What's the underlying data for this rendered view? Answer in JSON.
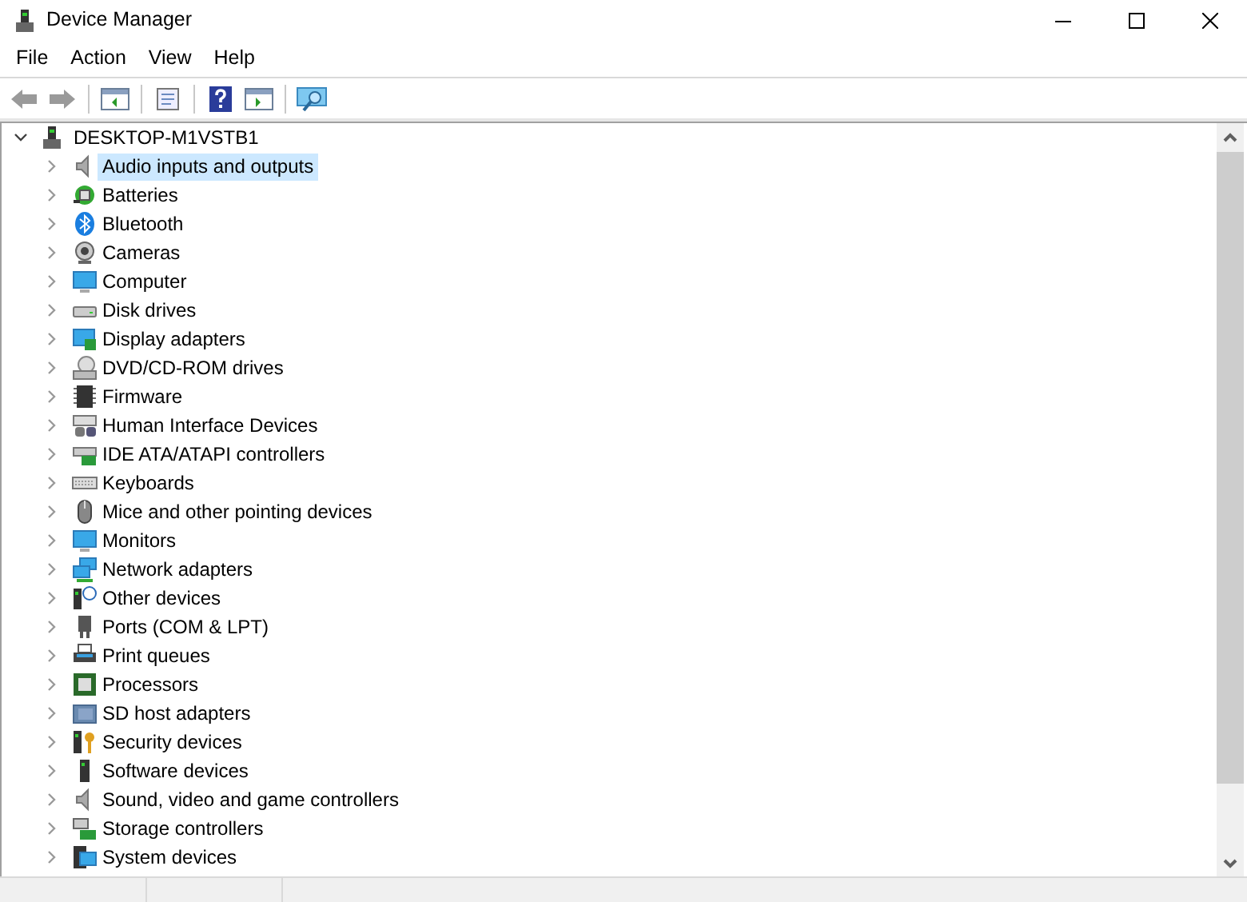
{
  "window": {
    "title": "Device Manager"
  },
  "menu": [
    "File",
    "Action",
    "View",
    "Help"
  ],
  "tree": {
    "label": "DESKTOP-M1VSTB1",
    "expanded": true,
    "children": [
      {
        "label": "Audio inputs and outputs",
        "selected": true,
        "expanded": false
      },
      {
        "label": "Batteries",
        "selected": false,
        "expanded": false
      },
      {
        "label": "Bluetooth",
        "selected": false,
        "expanded": false
      },
      {
        "label": "Cameras",
        "selected": false,
        "expanded": false
      },
      {
        "label": "Computer",
        "selected": false,
        "expanded": false
      },
      {
        "label": "Disk drives",
        "selected": false,
        "expanded": false
      },
      {
        "label": "Display adapters",
        "selected": false,
        "expanded": false
      },
      {
        "label": "DVD/CD-ROM drives",
        "selected": false,
        "expanded": false
      },
      {
        "label": "Firmware",
        "selected": false,
        "expanded": false
      },
      {
        "label": "Human Interface Devices",
        "selected": false,
        "expanded": false
      },
      {
        "label": "IDE ATA/ATAPI controllers",
        "selected": false,
        "expanded": false
      },
      {
        "label": "Keyboards",
        "selected": false,
        "expanded": false
      },
      {
        "label": "Mice and other pointing devices",
        "selected": false,
        "expanded": false
      },
      {
        "label": "Monitors",
        "selected": false,
        "expanded": false
      },
      {
        "label": "Network adapters",
        "selected": false,
        "expanded": false
      },
      {
        "label": "Other devices",
        "selected": false,
        "expanded": false
      },
      {
        "label": "Ports (COM & LPT)",
        "selected": false,
        "expanded": false
      },
      {
        "label": "Print queues",
        "selected": false,
        "expanded": false
      },
      {
        "label": "Processors",
        "selected": false,
        "expanded": false
      },
      {
        "label": "SD host adapters",
        "selected": false,
        "expanded": false
      },
      {
        "label": "Security devices",
        "selected": false,
        "expanded": false
      },
      {
        "label": "Software devices",
        "selected": false,
        "expanded": false
      },
      {
        "label": "Sound, video and game controllers",
        "selected": false,
        "expanded": false
      },
      {
        "label": "Storage controllers",
        "selected": false,
        "expanded": false
      },
      {
        "label": "System devices",
        "selected": false,
        "expanded": false
      }
    ]
  }
}
